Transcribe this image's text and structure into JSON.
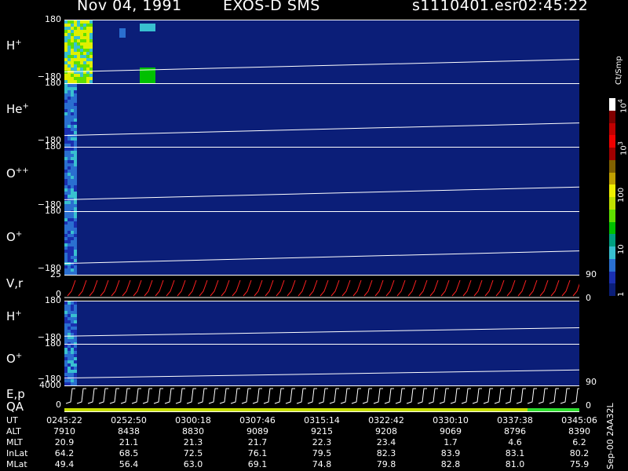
{
  "header": {
    "date": "Nov 04, 1991",
    "instrument": "EXOS-D SMS",
    "file": "s1110401.esr",
    "time": "02:45:22"
  },
  "panels": [
    {
      "label": "H",
      "charge": "+",
      "ymax": "180",
      "ymin": "−180"
    },
    {
      "label": "He",
      "charge": "+",
      "ymax": "180",
      "ymin": "−180"
    },
    {
      "label": "O",
      "charge": "++",
      "ymax": "180",
      "ymin": "−180"
    },
    {
      "label": "O",
      "charge": "+",
      "ymax": "180",
      "ymin": "−180"
    },
    {
      "label": "V,r",
      "charge": "",
      "ymax": "25",
      "ymin": "0"
    },
    {
      "label": "H",
      "charge": "+",
      "ymax": "180",
      "ymin": "−180"
    },
    {
      "label": "O",
      "charge": "+",
      "ymax": "180",
      "ymin": "−180"
    },
    {
      "label": "E,p",
      "charge": "",
      "label2": "QA",
      "ymax": "4000",
      "ymin": "0"
    }
  ],
  "right_ticks": {
    "vr_top": "90",
    "vr_bottom": "0",
    "ep_top": "90",
    "ep_bottom": "0"
  },
  "colorbar": {
    "unit": "Ct/Smp",
    "ticks": [
      "1",
      "10",
      "100",
      "10",
      "10"
    ],
    "tick_exponents": [
      "",
      "",
      "",
      "3",
      "4"
    ],
    "colors": [
      "#0b1e78",
      "#1a2fb0",
      "#2a6fd0",
      "#38c0d0",
      "#00a080",
      "#00c000",
      "#60e000",
      "#c0e000",
      "#f0f000",
      "#c0a000",
      "#806000",
      "#a00000",
      "#f00000",
      "#c00000",
      "#800000",
      "#ffffff"
    ]
  },
  "time_axis": {
    "rows": [
      "UT",
      "ALT",
      "MLT",
      "InLat",
      "MLat"
    ],
    "columns": [
      {
        "UT": "0245:22",
        "ALT": "7910",
        "MLT": "20.9",
        "InLat": "64.2",
        "MLat": "49.4"
      },
      {
        "UT": "0252:50",
        "ALT": "8438",
        "MLT": "21.1",
        "InLat": "68.5",
        "MLat": "56.4"
      },
      {
        "UT": "0300:18",
        "ALT": "8830",
        "MLT": "21.3",
        "InLat": "72.5",
        "MLat": "63.0"
      },
      {
        "UT": "0307:46",
        "ALT": "9089",
        "MLT": "21.7",
        "InLat": "76.1",
        "MLat": "69.1"
      },
      {
        "UT": "0315:14",
        "ALT": "9215",
        "MLT": "22.3",
        "InLat": "79.5",
        "MLat": "74.8"
      },
      {
        "UT": "0322:42",
        "ALT": "9208",
        "MLT": "23.4",
        "InLat": "82.3",
        "MLat": "79.8"
      },
      {
        "UT": "0330:10",
        "ALT": "9069",
        "MLT": "1.7",
        "InLat": "83.9",
        "MLat": "82.8"
      },
      {
        "UT": "0337:38",
        "ALT": "8796",
        "MLT": "4.6",
        "InLat": "83.1",
        "MLat": "81.0"
      },
      {
        "UT": "0345:06",
        "ALT": "8390",
        "MLT": "6.2",
        "InLat": "80.2",
        "MLat": "75.9"
      }
    ]
  },
  "footer_id": "Sep-00 2AA32L",
  "chart_data": {
    "type": "heatmap",
    "title": "Nov 04, 1991 EXOS-D SMS",
    "xlabel": "UT",
    "x_ticks": [
      "0245:22",
      "0252:50",
      "0300:18",
      "0307:46",
      "0315:14",
      "0322:42",
      "0330:10",
      "0337:38",
      "0345:06"
    ],
    "series": [
      {
        "name": "H+",
        "ylim": [
          -180,
          180
        ]
      },
      {
        "name": "He+",
        "ylim": [
          -180,
          180
        ]
      },
      {
        "name": "O++",
        "ylim": [
          -180,
          180
        ]
      },
      {
        "name": "O+",
        "ylim": [
          -180,
          180
        ]
      },
      {
        "name": "V,r",
        "ylim": [
          0,
          25
        ]
      },
      {
        "name": "H+",
        "ylim": [
          -180,
          180
        ]
      },
      {
        "name": "O+",
        "ylim": [
          -180,
          180
        ]
      },
      {
        "name": "E,p",
        "ylim": [
          0,
          4000
        ]
      }
    ],
    "colorbar_label": "Ct/Smp",
    "colorbar_ticks": [
      "1",
      "10",
      "100",
      "10^3",
      "10^4"
    ]
  }
}
